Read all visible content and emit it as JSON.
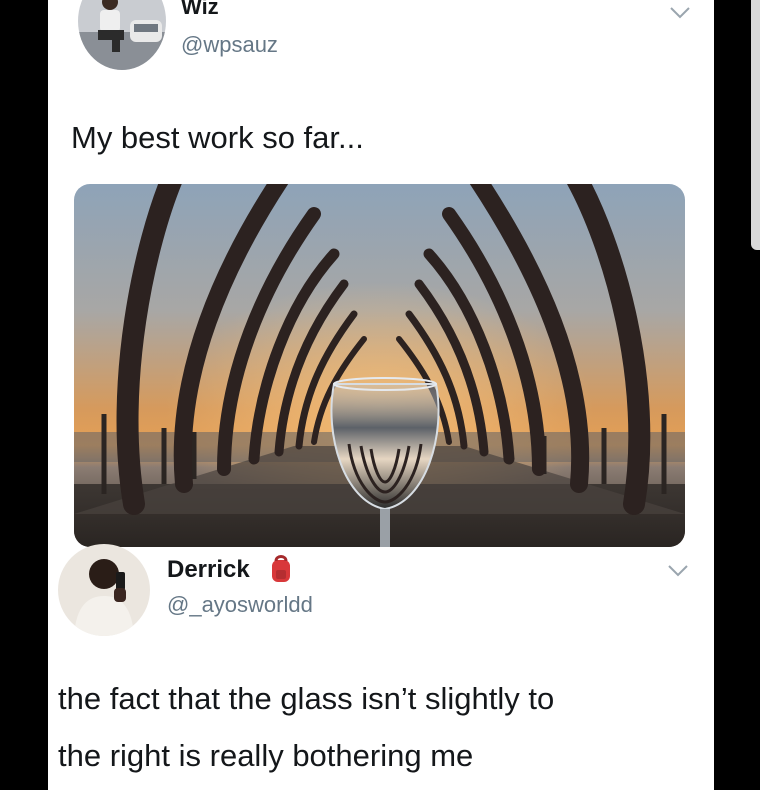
{
  "tweet": {
    "author_name": "Wiz",
    "author_handle": "@wpsauz",
    "text": "My best work so far...",
    "media_image": "pier-arches-sunset-wine-glass",
    "menu_icon": "chevron-down-icon"
  },
  "reply": {
    "author_name": "Derrick",
    "author_handle": "@_ayosworldd",
    "name_emoji": "backpack-icon",
    "text_line1": "the fact that the glass isn’t slightly to",
    "text_line2": "the right is really bothering me",
    "menu_icon": "chevron-down-icon"
  },
  "colors": {
    "background": "#000000",
    "card": "#ffffff",
    "text": "#14171a",
    "handle": "#657786",
    "badge": "#d8383a"
  }
}
